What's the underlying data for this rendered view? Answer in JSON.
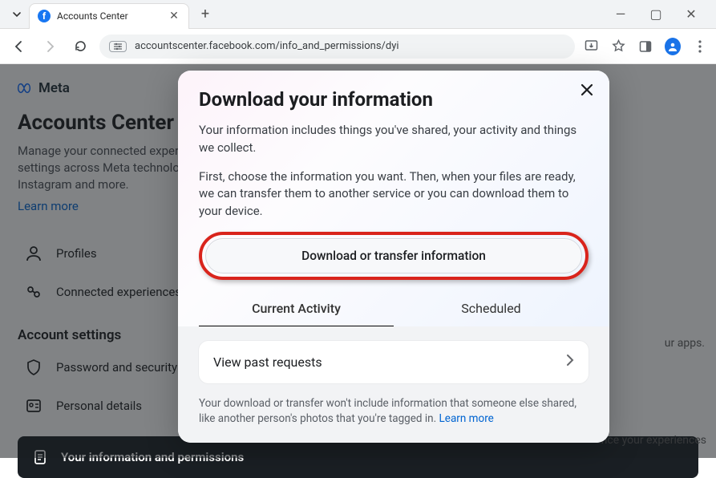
{
  "browser": {
    "tab_title": "Accounts Center",
    "url": "accountscenter.facebook.com/info_and_permissions/dyi"
  },
  "page": {
    "brand": "Meta",
    "title": "Accounts Center",
    "description": "Manage your connected experiences and account settings across Meta technologies like Facebook, Instagram and more.",
    "learn_more": "Learn more",
    "sidebar": {
      "profiles": "Profiles",
      "connected": "Connected experiences",
      "heading": "Account settings",
      "password": "Password and security",
      "personal": "Personal details",
      "active": "Your information and permissions"
    },
    "right_hints": {
      "apps": "ur apps.",
      "experiences": "nce your experiences"
    }
  },
  "modal": {
    "title": "Download your information",
    "p1": "Your information includes things you've shared, your activity and things we collect.",
    "p2": "First, choose the information you want. Then, when your files are ready, we can transfer them to another service or you can download them to your device.",
    "primary_action": "Download or transfer information",
    "tabs": {
      "current": "Current Activity",
      "scheduled": "Scheduled"
    },
    "past_requests": "View past requests",
    "footnote": "Your download or transfer won't include information that someone else shared, like another person's photos that you're tagged in. ",
    "footnote_link": "Learn more"
  }
}
